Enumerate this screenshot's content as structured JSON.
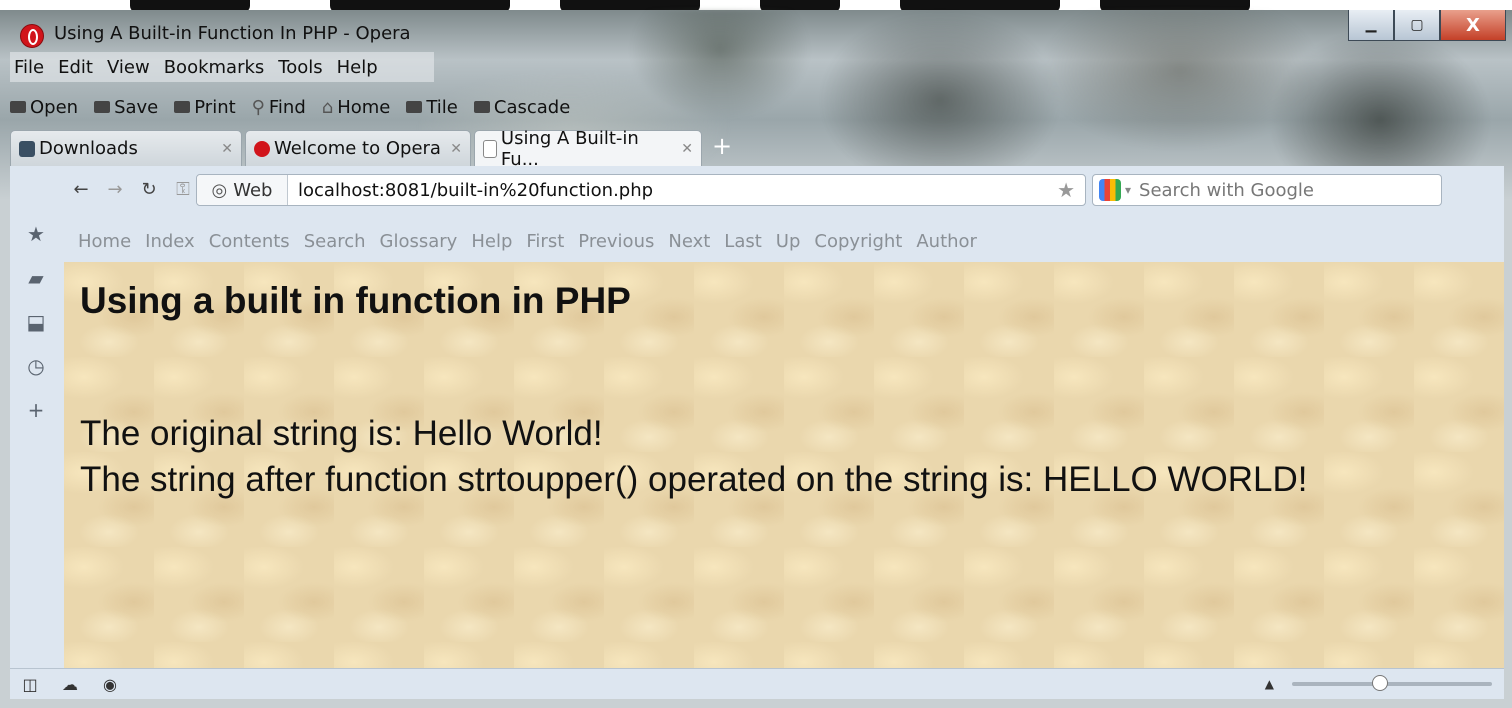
{
  "window": {
    "title": "Using A Built-in Function In PHP - Opera",
    "minimize_icon": "minimize-icon",
    "maximize_icon": "maximize-icon",
    "close_icon": "close-icon"
  },
  "menu": {
    "items": [
      "File",
      "Edit",
      "View",
      "Bookmarks",
      "Tools",
      "Help"
    ]
  },
  "toolbar": {
    "items": [
      {
        "label": "Open",
        "icon": "folder-icon"
      },
      {
        "label": "Save",
        "icon": "save-icon"
      },
      {
        "label": "Print",
        "icon": "print-icon"
      },
      {
        "label": "Find",
        "icon": "find-icon"
      },
      {
        "label": "Home",
        "icon": "home-icon"
      },
      {
        "label": "Tile",
        "icon": "tile-icon"
      },
      {
        "label": "Cascade",
        "icon": "cascade-icon"
      }
    ]
  },
  "tabs": [
    {
      "label": "Downloads",
      "icon": "downloads-icon",
      "active": false
    },
    {
      "label": "Welcome to Opera",
      "icon": "opera-icon",
      "active": false
    },
    {
      "label": "Using A Built-in Fu...",
      "icon": "page-icon",
      "active": true
    }
  ],
  "address": {
    "chip_label": "Web",
    "url": "localhost:8081/built-in%20function.php"
  },
  "search": {
    "placeholder": "Search with Google"
  },
  "linkbar": {
    "items": [
      "Home",
      "Index",
      "Contents",
      "Search",
      "Glossary",
      "Help",
      "First",
      "Previous",
      "Next",
      "Last",
      "Up",
      "Copyright",
      "Author"
    ]
  },
  "page": {
    "heading": "Using a built in function in PHP",
    "line1": "The original string is: Hello World!",
    "line2": "The string after function strtoupper() operated on the string is: HELLO WORLD!"
  },
  "colors": {
    "page_background": "#ead7ad",
    "chrome": "#dde6f0",
    "opera_red": "#d1141b"
  }
}
